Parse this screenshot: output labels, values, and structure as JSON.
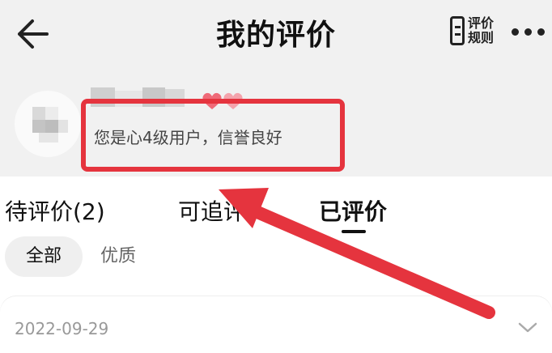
{
  "header": {
    "title": "我的评价",
    "rules_button": {
      "label": "评价规则",
      "icon": "document-rules-icon"
    },
    "back_icon": "arrow-left-icon",
    "more_icon": "ellipsis-icon"
  },
  "profile": {
    "level_text": "您是心4级用户，信誉良好",
    "badge_icon": "hearts-badge-icon"
  },
  "tabs": [
    {
      "label": "待评价(2)",
      "active": false
    },
    {
      "label": "可追评",
      "active": false
    },
    {
      "label": "已评价",
      "active": true
    }
  ],
  "filters": [
    {
      "label": "全部",
      "selected": true
    },
    {
      "label": "优质",
      "selected": false
    }
  ],
  "review": {
    "date": "2022-09-29",
    "expand_icon": "chevron-down-icon"
  },
  "colors": {
    "annotation": "#e5343e",
    "background": "#f1f1f1",
    "panel": "#ffffff"
  }
}
